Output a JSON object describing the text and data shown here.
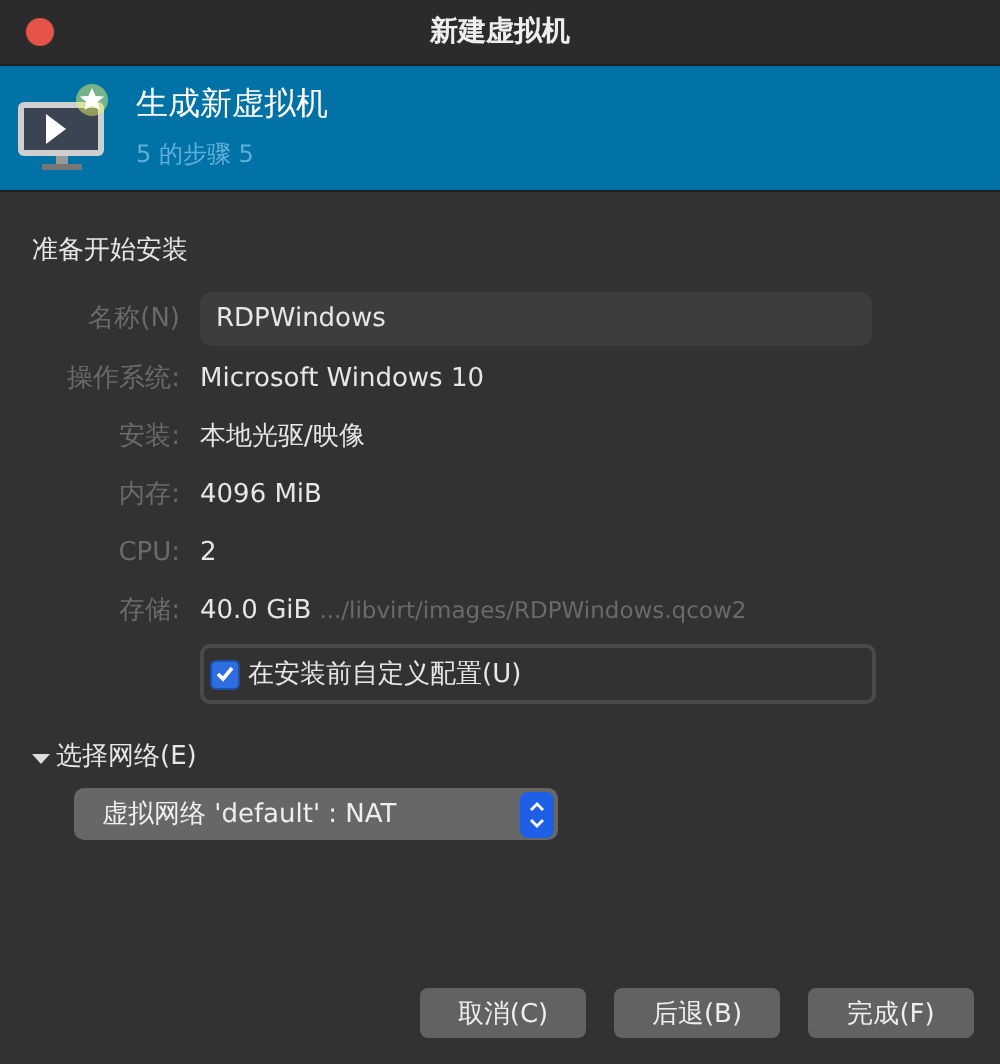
{
  "window": {
    "title": "新建虚拟机"
  },
  "header": {
    "title": "生成新虚拟机",
    "subtitle": "5 的步骤 5"
  },
  "section_title": "准备开始安装",
  "details": [
    {
      "kind": "input",
      "label": "名称(N)",
      "value": "RDPWindows"
    },
    {
      "kind": "text",
      "label": "操作系统:",
      "value": "Microsoft Windows 10"
    },
    {
      "kind": "text",
      "label": "安装:",
      "value": "本地光驱/映像"
    },
    {
      "kind": "text",
      "label": "内存:",
      "value": "4096 MiB"
    },
    {
      "kind": "text",
      "label": "CPU:",
      "value": "2"
    },
    {
      "kind": "storage",
      "label": "存储:",
      "value": "40.0 GiB",
      "path": ".../libvirt/images/RDPWindows.qcow2"
    }
  ],
  "customize": {
    "label": "在安装前自定义配置(U)",
    "checked": true
  },
  "network": {
    "label": "选择网络(E)",
    "expanded": true,
    "select": "虚拟网络 'default' : NAT"
  },
  "buttons": [
    "取消(C)",
    "后退(B)",
    "完成(F)"
  ]
}
